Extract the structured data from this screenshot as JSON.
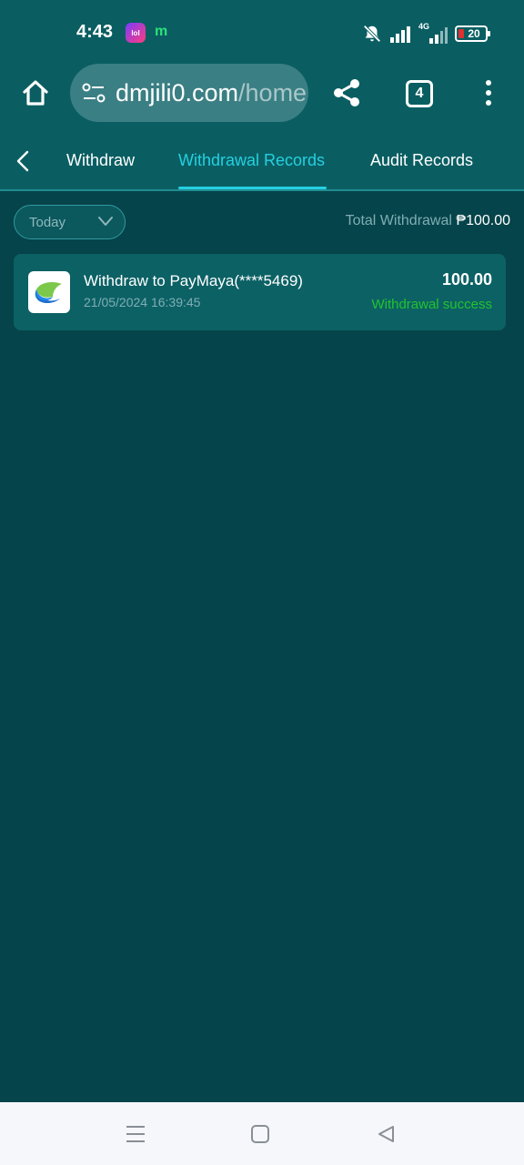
{
  "status_bar": {
    "time": "4:43",
    "app_icon_text": "lol",
    "notification_letter": "m",
    "network": "4G",
    "battery": "20"
  },
  "browser": {
    "url_domain": "dmjili0.com",
    "url_path": "/home",
    "tab_count": "4"
  },
  "tabs": [
    {
      "label": "Withdraw",
      "active": false
    },
    {
      "label": "Withdrawal Records",
      "active": true
    },
    {
      "label": "Audit Records",
      "active": false
    }
  ],
  "filter": {
    "selected": "Today",
    "total_label": "Total Withdrawal",
    "total_value": "₱100.00"
  },
  "records": [
    {
      "title": "Withdraw to PayMaya(****5469)",
      "date": "21/05/2024 16:39:45",
      "amount": "100.00",
      "status": "Withdrawal success"
    }
  ],
  "colors": {
    "background": "#05444a",
    "header": "#0a5e62",
    "accent": "#25d0e0",
    "success": "#22c42c"
  }
}
